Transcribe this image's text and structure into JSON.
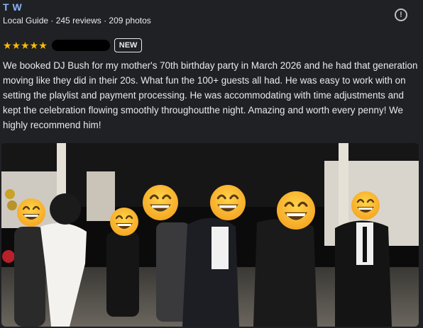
{
  "reviewer": {
    "name": "T W",
    "meta": "Local Guide · 245 reviews · 209 photos"
  },
  "report_icon": "exclamation-circle-icon",
  "rating": {
    "stars": 5,
    "stars_text": "★★★★★",
    "badge": "NEW"
  },
  "review": {
    "text": "We booked DJ Bush for my mother's 70th birthday party in March 2026 and he had that generation moving like they did in their 20s. What fun the 100+ guests all had. He was easy to work with on setting the playlist and payment processing. He was accommodating with time adjustments and kept the celebration flowing smoothly throughoutthe night. Amazing and worth every penny! We highly recommend him!"
  },
  "photo": {
    "subject": "party-dance-floor-photo",
    "face_cover": "grinning-face-emoji"
  },
  "colors": {
    "background": "#202124",
    "name": "#8ab4f8",
    "stars": "#fbbc04",
    "text": "#e8eaed"
  }
}
